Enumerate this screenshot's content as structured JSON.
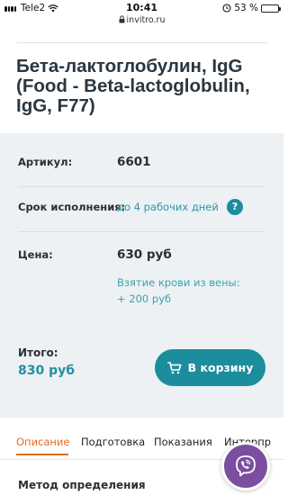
{
  "status_bar": {
    "carrier": "Tele2",
    "time": "10:41",
    "url": "invitro.ru",
    "battery": "53 %",
    "battery_level": 0.53
  },
  "product": {
    "title": "Бета-лактоглобулин, IgG (Food - Beta-lactoglobulin, IgG, F77)"
  },
  "details": {
    "article_label": "Артикул:",
    "article_value": "6601",
    "term_label": "Срок исполнения:",
    "term_value": "до 4 рабочих дней",
    "help_label": "?",
    "price_label": "Цена:",
    "price_value": "630 руб",
    "blood_draw_line1": "Взятие крови из вены:",
    "blood_draw_line2": "+ 200 руб",
    "total_label": "Итого:",
    "total_value": "830 руб",
    "cart_button_label": "В корзину"
  },
  "tabs": [
    {
      "label": "Описание",
      "active": true
    },
    {
      "label": "Подготовка",
      "active": false
    },
    {
      "label": "Показания",
      "active": false
    },
    {
      "label": "Интерпр",
      "active": false
    }
  ],
  "content": {
    "method_title": "Метод определения"
  },
  "colors": {
    "accent": "#1b8d9c",
    "tab_active": "#e56b20",
    "viber": "#7b4ea0",
    "panel_bg": "#edf1f4"
  },
  "icons": {
    "wifi": "wifi-icon",
    "lock": "lock-icon",
    "alarm": "alarm-icon",
    "cart": "cart-icon",
    "viber": "viber-phone-icon"
  }
}
